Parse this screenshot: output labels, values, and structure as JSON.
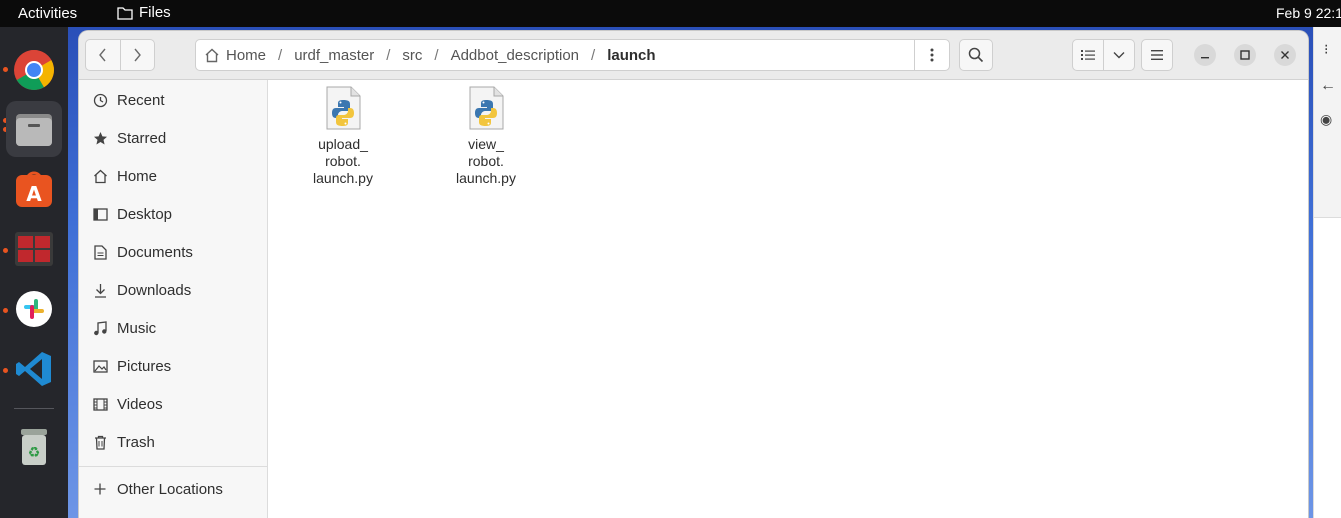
{
  "topbar": {
    "activities": "Activities",
    "app_name": "Files",
    "clock": "Feb 9  22:1"
  },
  "dock": {
    "items": [
      "chrome-icon",
      "files-icon",
      "app-center-icon",
      "terminal-app-icon",
      "slack-icon",
      "vscode-icon",
      "trash-icon"
    ]
  },
  "window": {
    "path": {
      "crumbs": [
        "Home",
        "urdf_master",
        "src",
        "Addbot_description",
        "launch"
      ],
      "separator": "/"
    }
  },
  "sidebar": {
    "items": [
      {
        "label": "Recent",
        "icon": "clock-icon"
      },
      {
        "label": "Starred",
        "icon": "star-icon"
      },
      {
        "label": "Home",
        "icon": "home-icon"
      },
      {
        "label": "Desktop",
        "icon": "desktop-icon"
      },
      {
        "label": "Documents",
        "icon": "document-icon"
      },
      {
        "label": "Downloads",
        "icon": "download-icon"
      },
      {
        "label": "Music",
        "icon": "music-icon"
      },
      {
        "label": "Pictures",
        "icon": "picture-icon"
      },
      {
        "label": "Videos",
        "icon": "video-icon"
      },
      {
        "label": "Trash",
        "icon": "trash-icon"
      }
    ],
    "other_locations": "Other Locations"
  },
  "files": [
    {
      "line1": "upload_",
      "line2": "robot.",
      "line3": "launch.py",
      "icon": "python-file-icon"
    },
    {
      "line1": "view_",
      "line2": "robot.",
      "line3": "launch.py",
      "icon": "python-file-icon"
    }
  ],
  "colors": {
    "accent": "#e95420",
    "python_blue": "#3b77b0",
    "python_yellow": "#f2c53d"
  }
}
